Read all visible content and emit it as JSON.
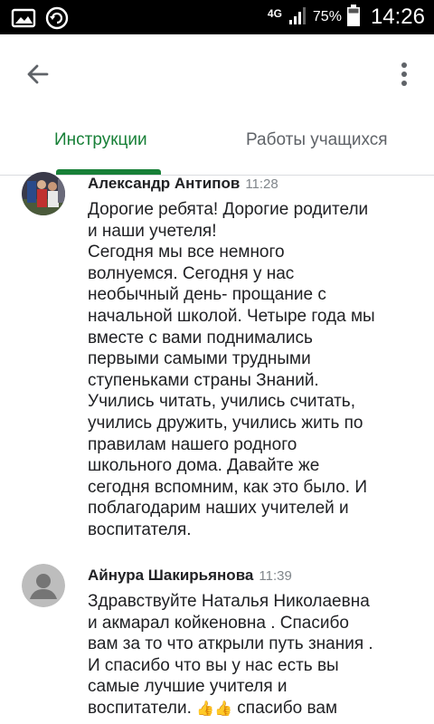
{
  "status_bar": {
    "network_type": "4G",
    "battery": "75%",
    "time": "14:26",
    "icons": [
      "gallery-icon",
      "sync-icon",
      "signal-icon",
      "battery-icon"
    ]
  },
  "app_bar": {
    "back_icon": "arrow-back-icon",
    "menu_icon": "more-vert-icon"
  },
  "tabs": [
    {
      "label": "Инструкции",
      "active": true
    },
    {
      "label": "Работы учащихся",
      "active": false
    }
  ],
  "colors": {
    "accent": "#188038",
    "text": "#202124",
    "secondary": "#5f6368",
    "status_bar": "#000000"
  },
  "comments": [
    {
      "author": "Александр Антипов",
      "time": "11:28",
      "text": "Дорогие ребята! Дорогие родители\nи наши учетеля!\nСегодня мы все немного\nволнуемся. Сегодня у нас\nнеобычный день- прощание с\nначальной школой. Четыре года мы\nвместе с вами поднимались\nпервыми самыми трудными\nступеньками страны Знаний.\nУчились читать, учились считать,\nучились дружить, учились жить по\nправилам нашего родного\nшкольного дома. Давайте же\nсегодня вспомним, как это было. И\nпоблагодарим наших учителей и\nвоспитателя.",
      "avatar": "photo"
    },
    {
      "author": "Айнура Шакирьянова",
      "time": "11:39",
      "text": "Здравствуйте Наталья Николаевна\nи акмарал койкеновна . Спасибо\nвам за то что аткрыли путь знания .\nИ спасибо что вы у нас есть вы\nсамые  лучшие учителя и\nвоспитатели.",
      "text_end": "спасибо вам",
      "emoji": "👍👍",
      "avatar": "default-person"
    }
  ]
}
